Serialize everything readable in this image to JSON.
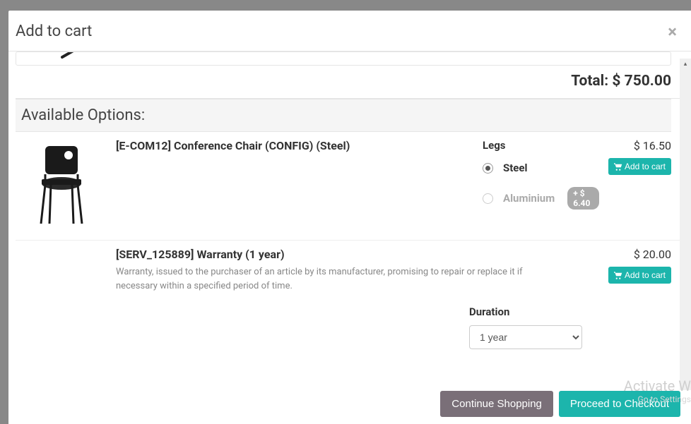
{
  "modal": {
    "title": "Add to cart",
    "close": "×"
  },
  "total": {
    "label": "Total:",
    "value": "$ 750.00"
  },
  "sections": {
    "options_header": "Available Options:"
  },
  "options": [
    {
      "title": "[E-COM12] Conference Chair (CONFIG) (Steel)",
      "config_label": "Legs",
      "radios": [
        {
          "label": "Steel",
          "selected": true
        },
        {
          "label": "Aluminium",
          "selected": false,
          "surcharge": "+ $ 6.40"
        }
      ],
      "price": "$ 16.50",
      "add_label": "Add to cart"
    },
    {
      "title": "[SERV_125889] Warranty (1 year)",
      "description": "Warranty, issued to the purchaser of an article by its manufacturer, promising to repair or replace it if necessary within a specified period of time.",
      "config_label": "Duration",
      "duration_value": "1 year",
      "price": "$ 20.00",
      "add_label": "Add to cart"
    }
  ],
  "footer": {
    "continue": "Continue Shopping",
    "checkout": "Proceed to Checkout"
  },
  "watermark": {
    "line1": "Activate W",
    "line2": "Go to Settings"
  },
  "icons": {
    "cart": "cart-icon"
  }
}
